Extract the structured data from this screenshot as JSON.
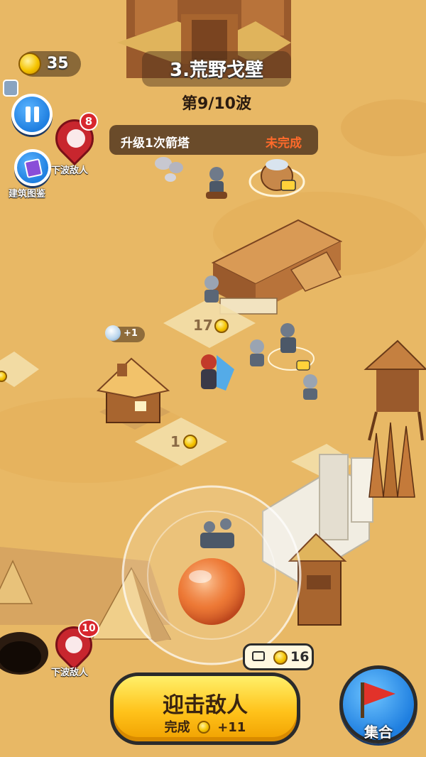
{
  "level": {
    "title": "3.荒野戈壁",
    "wave": "第9/10波"
  },
  "resources": {
    "coins": "35"
  },
  "side_buttons": {
    "pause_icon": "pause-icon",
    "enemy_label_top": "下波敌人",
    "enemy_count_top": "8",
    "codex_label": "建筑图鉴"
  },
  "task": {
    "text": "升级1次箭塔",
    "status": "未完成",
    "status_color": "#ff6a2a"
  },
  "map": {
    "tile_cost_a": "17",
    "tile_cost_b": "1",
    "gem_bonus": "+1"
  },
  "bottom_enemy": {
    "label": "下波敌人",
    "count": "10"
  },
  "video_reward": {
    "amount": "16"
  },
  "main_action": {
    "label": "迎击敌人",
    "sub_label": "完成",
    "reward": "+11"
  },
  "rally": {
    "label": "集合"
  },
  "colors": {
    "sand": "#e8b865",
    "accent_yellow": "#ffc21a",
    "blue_button": "#1f7fe0",
    "enemy_red": "#d8262e"
  }
}
